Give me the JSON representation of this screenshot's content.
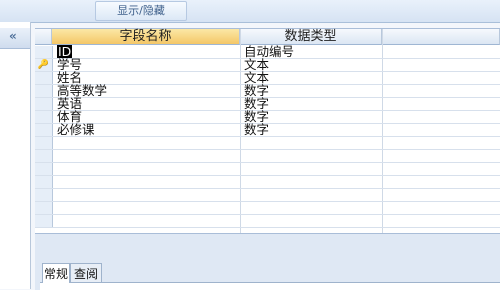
{
  "ribbon": {
    "show_hide_label": "显示/隐藏"
  },
  "nav": {
    "collapse_label": "«"
  },
  "grid": {
    "columns": [
      "字段名称",
      "数据类型"
    ],
    "rows": [
      {
        "name": "ID",
        "type": "自动编号",
        "key": false
      },
      {
        "name": "学号",
        "type": "文本",
        "key": true
      },
      {
        "name": "姓名",
        "type": "文本",
        "key": false
      },
      {
        "name": "高等数学",
        "type": "数字",
        "key": false
      },
      {
        "name": "英语",
        "type": "数字",
        "key": false
      },
      {
        "name": "体育",
        "type": "数字",
        "key": false
      },
      {
        "name": "必修课",
        "type": "数字",
        "key": false
      }
    ]
  },
  "properties": {
    "tabs": [
      "常规",
      "查阅"
    ]
  }
}
